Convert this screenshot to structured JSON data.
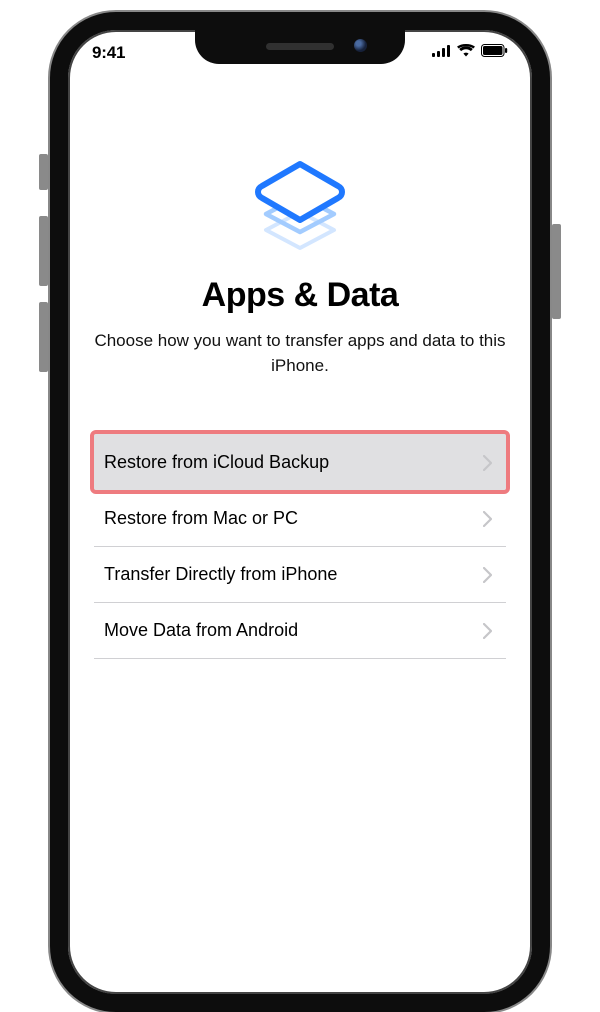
{
  "statusBar": {
    "time": "9:41"
  },
  "page": {
    "title": "Apps & Data",
    "subtitle": "Choose how you want to transfer apps and data to this iPhone."
  },
  "options": {
    "items": [
      {
        "label": "Restore from iCloud Backup",
        "highlighted": true
      },
      {
        "label": "Restore from Mac or PC",
        "highlighted": false
      },
      {
        "label": "Transfer Directly from iPhone",
        "highlighted": false
      },
      {
        "label": "Move Data from Android",
        "highlighted": false
      }
    ]
  },
  "colors": {
    "accent": "#1f78ff",
    "highlightOutline": "#ee7b7f"
  }
}
